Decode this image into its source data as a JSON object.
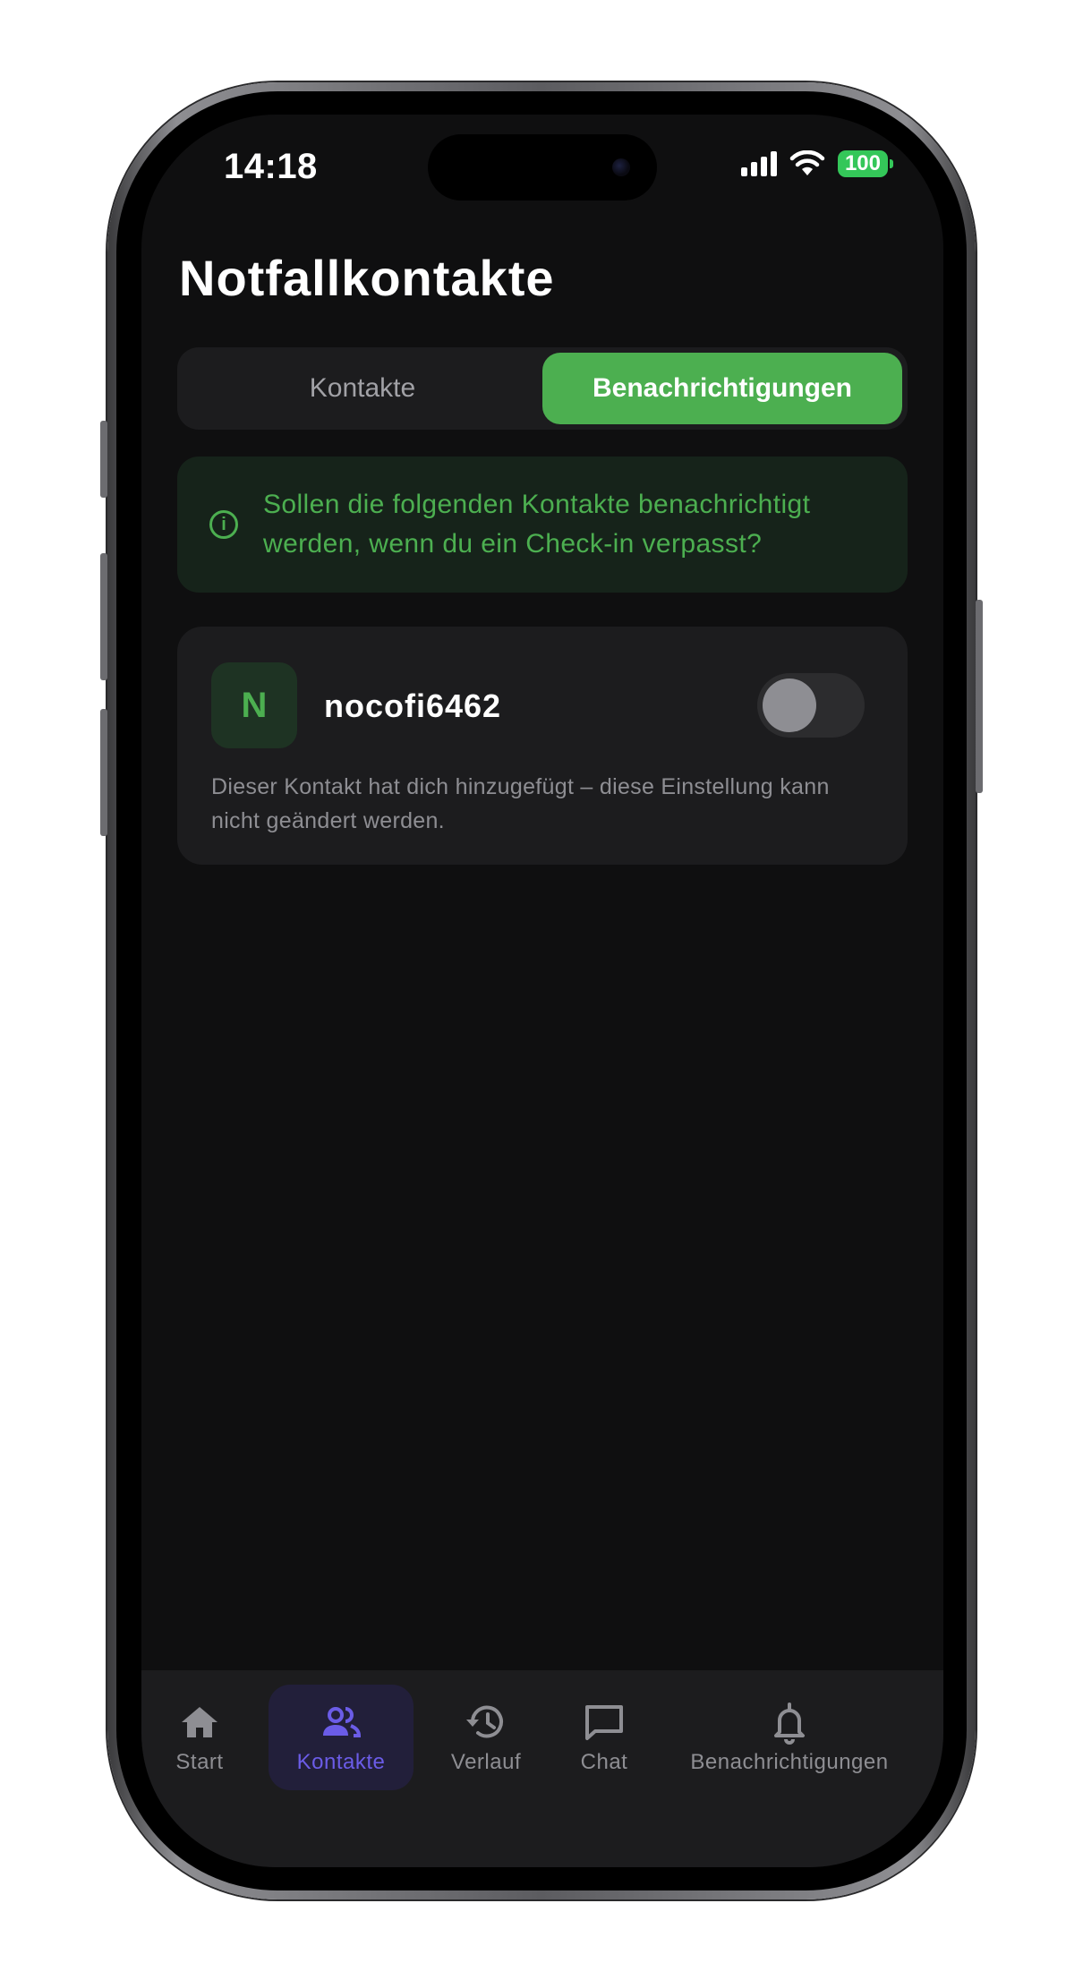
{
  "status_bar": {
    "time": "14:18",
    "battery": "100"
  },
  "page": {
    "title": "Notfallkontakte"
  },
  "segment": {
    "tabs": [
      {
        "label": "Kontakte",
        "active": false
      },
      {
        "label": "Benachrichtigungen",
        "active": true
      }
    ]
  },
  "info": {
    "text": "Sollen die folgenden Kontakte benachrichtigt werden, wenn du ein Check-in verpasst?"
  },
  "contact": {
    "initial": "N",
    "name": "nocofi6462",
    "notify_enabled": false,
    "note": "Dieser Kontakt hat dich hinzugefügt – diese Einstellung kann nicht geändert werden."
  },
  "tabbar": {
    "items": [
      {
        "label": "Start",
        "icon": "home-icon"
      },
      {
        "label": "Kontakte",
        "icon": "contacts-icon",
        "active": true
      },
      {
        "label": "Verlauf",
        "icon": "history-icon"
      },
      {
        "label": "Chat",
        "icon": "chat-icon"
      },
      {
        "label": "Benachrichtigungen",
        "icon": "bell-icon"
      }
    ]
  },
  "colors": {
    "accent_green": "#4caf50",
    "accent_purple": "#6b5ce7",
    "background": "#0f0f10",
    "surface": "#1c1c1e"
  }
}
